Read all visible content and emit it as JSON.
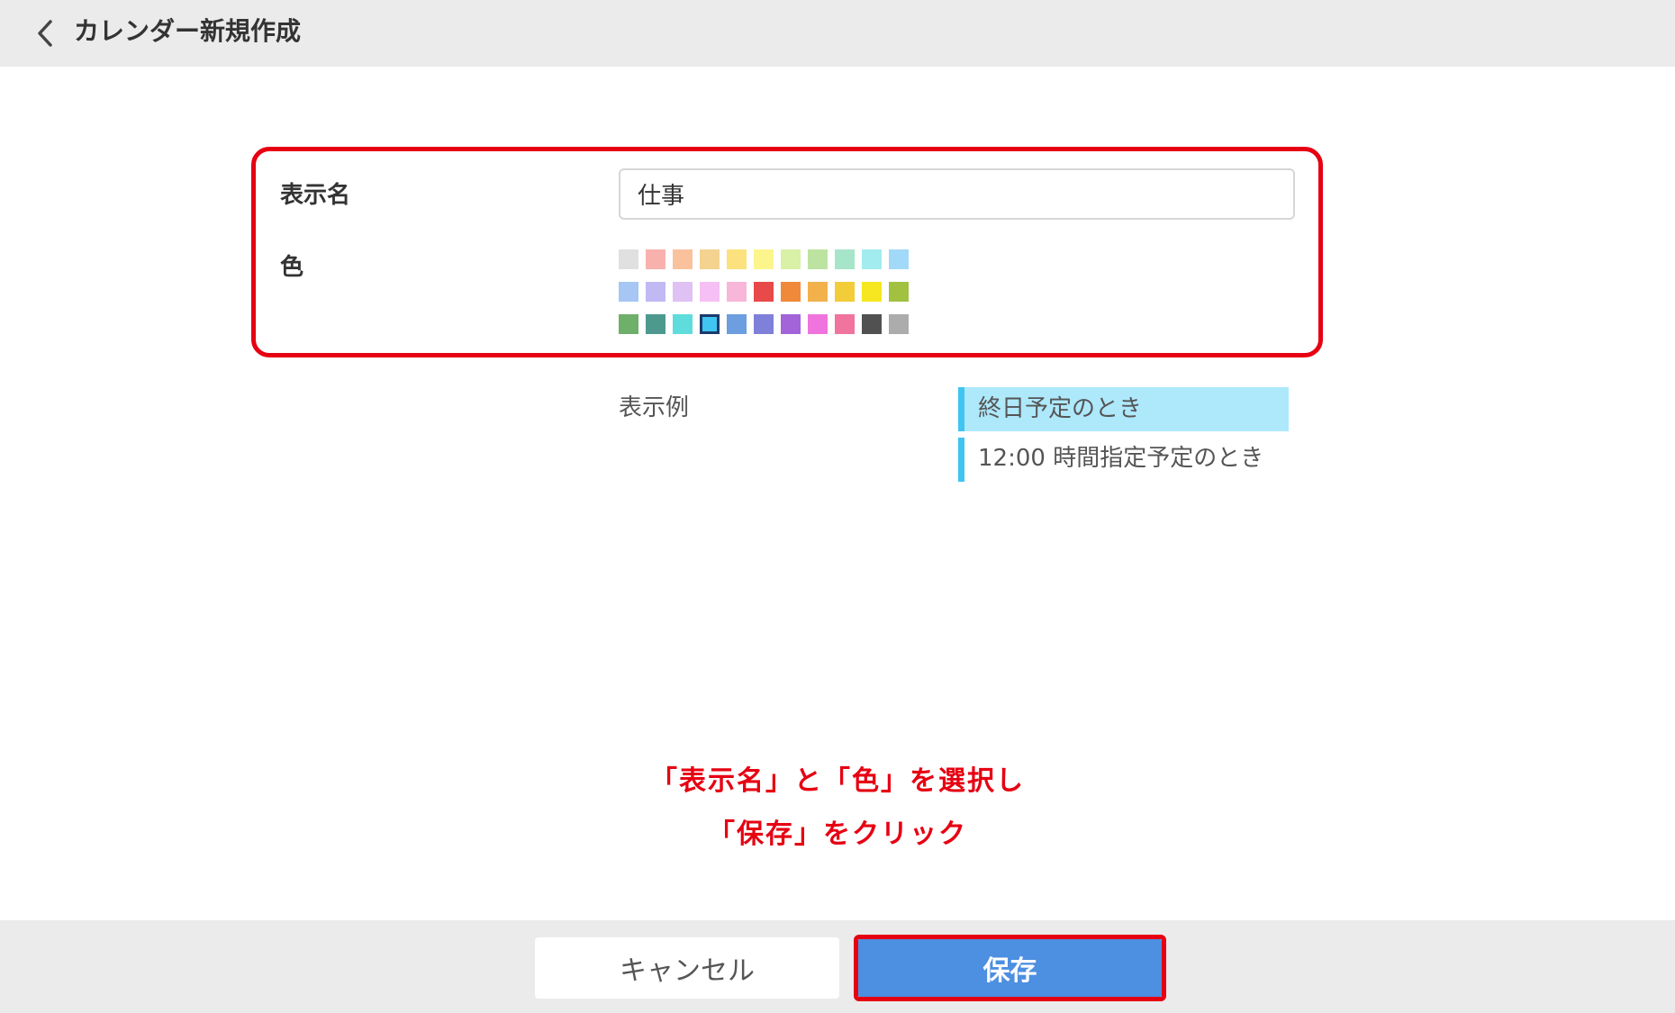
{
  "header": {
    "back_icon": "chevron-left-icon",
    "title": "カレンダー新規作成"
  },
  "form": {
    "name_label": "表示名",
    "name_value": "仕事",
    "color_label": "色",
    "highlight_color": "#e60012",
    "colors": [
      "#e0e0e0",
      "#f9b1ad",
      "#f9c29d",
      "#f4d28f",
      "#fbe27e",
      "#fbf58c",
      "#d9f0a7",
      "#bde3a0",
      "#a6e5c9",
      "#a2ecf0",
      "#a3d9f8",
      "#a6c6f4",
      "#c1b9f4",
      "#dfc1f4",
      "#f6c0f4",
      "#f8b6d8",
      "#e84949",
      "#f08a3a",
      "#f2b14a",
      "#f3cc39",
      "#f6e720",
      "#a2c141",
      "#6eaf6a",
      "#4d998e",
      "#5fdcdc",
      "#40c4f0",
      "#6c9ee0",
      "#7f80d9",
      "#a264d8",
      "#f074dd",
      "#f0749e",
      "#515151",
      "#acacac"
    ],
    "selected_color": "#40c4f0"
  },
  "preview": {
    "label": "表示例",
    "allday_text": "終日予定のとき",
    "timed_text": "12:00 時間指定予定のとき"
  },
  "instruction": {
    "line1": "「表示名」と「色」を選択し",
    "line2": "「保存」をクリック"
  },
  "footer": {
    "cancel_label": "キャンセル",
    "save_label": "保存"
  }
}
